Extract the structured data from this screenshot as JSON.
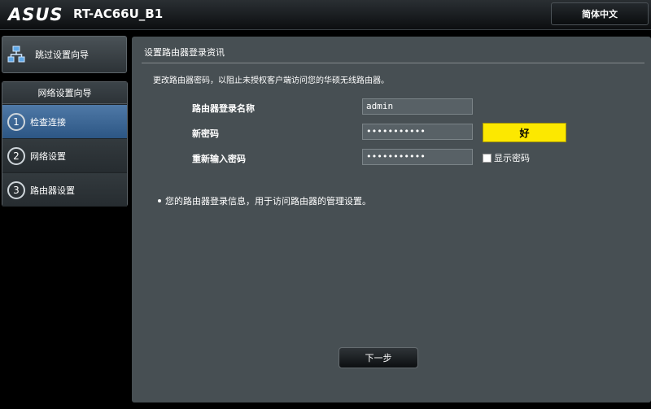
{
  "header": {
    "brand": "ASUS",
    "model": "RT-AC66U_B1",
    "language": "简体中文"
  },
  "sidebar": {
    "skip_label": "跳过设置向导",
    "wizard_title": "网络设置向导",
    "items": [
      {
        "num": "1",
        "label": "检查连接",
        "active": true
      },
      {
        "num": "2",
        "label": "网络设置",
        "active": false
      },
      {
        "num": "3",
        "label": "路由器设置",
        "active": false
      }
    ]
  },
  "main": {
    "title": "设置路由器登录资讯",
    "description": "更改路由器密码，以阻止未授权客户端访问您的华硕无线路由器。",
    "login_name_label": "路由器登录名称",
    "login_name_value": "admin",
    "new_password_label": "新密码",
    "new_password_value": "•••••••••••",
    "strength_label": "好",
    "confirm_password_label": "重新输入密码",
    "confirm_password_value": "•••••••••••",
    "show_password_label": "显示密码",
    "note_text": "您的路由器登录信息，用于访问路由器的管理设置。",
    "next_label": "下一步"
  },
  "colors": {
    "active_nav": "#3e6a99",
    "strength": "#fce800",
    "panel": "#474f53"
  }
}
